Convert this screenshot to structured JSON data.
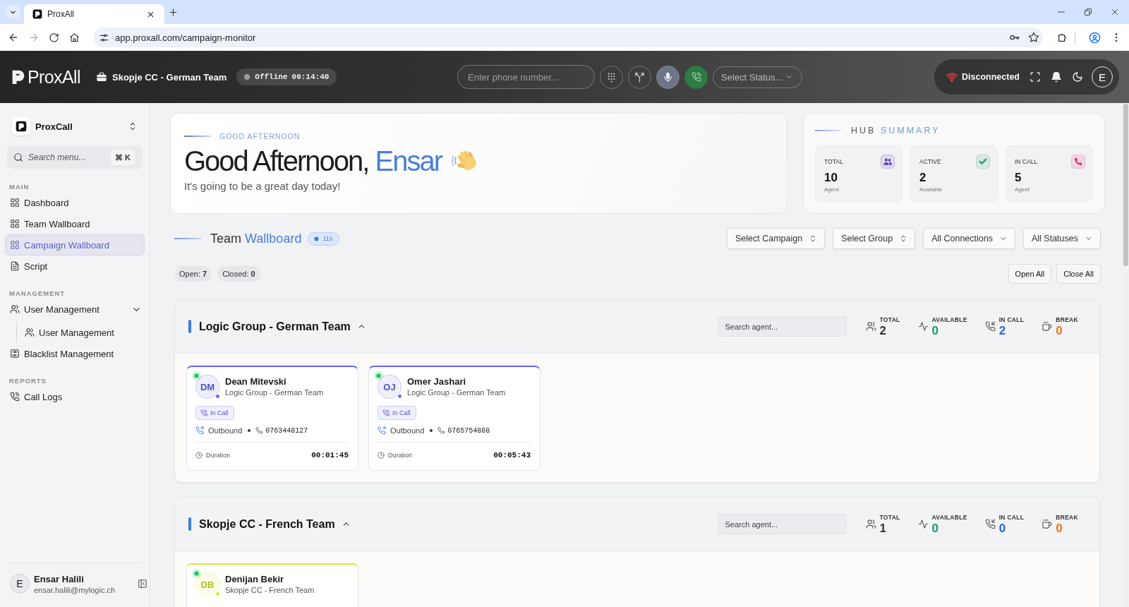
{
  "browser": {
    "tab": {
      "title": "ProxAll"
    },
    "url": "app.proxall.com/campaign-monitor"
  },
  "header": {
    "logo": "ProxAll",
    "team": "Skopje CC - German Team",
    "presence": {
      "label": "Offline",
      "timer": "00:14:40"
    },
    "phone_field": {
      "placeholder": "Enter phone number..."
    },
    "status_select": {
      "placeholder": "Select Status..."
    },
    "connection": {
      "label": "Disconnected",
      "connected": false
    },
    "user_initial": "E"
  },
  "sidebar": {
    "workspace": "ProxCall",
    "search": {
      "placeholder": "Search menu...",
      "shortcut": "⌘ K"
    },
    "sections": [
      {
        "title": "MAIN",
        "items": [
          {
            "label": "Dashboard",
            "selected": false
          },
          {
            "label": "Team Wallboard",
            "selected": false
          },
          {
            "label": "Campaign Wallboard",
            "selected": true
          },
          {
            "label": "Script",
            "selected": false
          }
        ]
      },
      {
        "title": "MANAGEMENT",
        "items": [
          {
            "label": "User Management",
            "selected": false,
            "expanded": true,
            "children": [
              {
                "label": "User Management",
                "selected": false
              }
            ]
          },
          {
            "label": "Blacklist Management",
            "selected": false
          }
        ]
      },
      {
        "title": "REPORTS",
        "items": [
          {
            "label": "Call Logs",
            "selected": false
          }
        ]
      }
    ],
    "user": {
      "initial": "E",
      "name": "Ensar Halili",
      "email": "ensar.halili@mylogic.ch"
    }
  },
  "greeting": {
    "eyebrow": "GOOD AFTERNOON",
    "text": "Good Afternoon,",
    "name": "Ensar",
    "subtitle": "It's going to be a great day today!"
  },
  "hub_summary": {
    "title": "HUB",
    "title_accent": "SUMMARY",
    "tiles": [
      {
        "label": "TOTAL",
        "value": "10",
        "caption": "Agent",
        "color": "#5b3fb8"
      },
      {
        "label": "ACTIVE",
        "value": "2",
        "caption": "Available",
        "color": "#2aa86a"
      },
      {
        "label": "IN CALL",
        "value": "5",
        "caption": "Agent",
        "color": "#e0357a"
      }
    ]
  },
  "wallboard": {
    "title": "Team",
    "title_accent": "Wallboard",
    "refresh": "11s",
    "filters": [
      {
        "label": "Select Campaign",
        "kind": "combobox"
      },
      {
        "label": "Select Group",
        "kind": "combobox"
      },
      {
        "label": "All Connections",
        "kind": "dropdown"
      },
      {
        "label": "All Statuses",
        "kind": "dropdown"
      }
    ],
    "counts": [
      "Open: **7**",
      "Closed: **0**"
    ],
    "actions": [
      "Open All",
      "Close All"
    ],
    "groups": [
      {
        "title": "Logic Group - German Team",
        "expanded": true,
        "search": {
          "placeholder": "Search agent..."
        },
        "stats": [
          {
            "label": "TOTAL",
            "value": "2",
            "color": "#333333"
          },
          {
            "label": "AVAILABLE",
            "value": "0",
            "color": "#159a63"
          },
          {
            "label": "IN CALL",
            "value": "2",
            "color": "#2563eb"
          },
          {
            "label": "BREAK",
            "value": "0",
            "color": "#f2761c"
          }
        ],
        "agents": [
          {
            "initials": "DM",
            "name": "Dean Mitevski",
            "team": "Logic Group - German Team",
            "color": "#6366f1",
            "online": true,
            "status": "In Call",
            "direction": "Outbound",
            "phone": "0763448127",
            "duration_label": "Duration",
            "duration": "00:01:45"
          },
          {
            "initials": "OJ",
            "name": "Omer Jashari",
            "team": "Logic Group - German Team",
            "color": "#6366f1",
            "online": true,
            "status": "In Call",
            "direction": "Outbound",
            "phone": "0765754888",
            "duration_label": "Duration",
            "duration": "00:05:43"
          }
        ]
      },
      {
        "title": "Skopje CC - French Team",
        "expanded": true,
        "search": {
          "placeholder": "Search agent..."
        },
        "stats": [
          {
            "label": "TOTAL",
            "value": "1",
            "color": "#333333"
          },
          {
            "label": "AVAILABLE",
            "value": "0",
            "color": "#159a63"
          },
          {
            "label": "IN CALL",
            "value": "0",
            "color": "#2563eb"
          },
          {
            "label": "BREAK",
            "value": "0",
            "color": "#f2761c"
          }
        ],
        "agents": [
          {
            "initials": "DB",
            "name": "Denijan Bekir",
            "team": "Skopje CC - French Team",
            "color": "#d4ee2e",
            "online": true
          }
        ]
      }
    ]
  }
}
